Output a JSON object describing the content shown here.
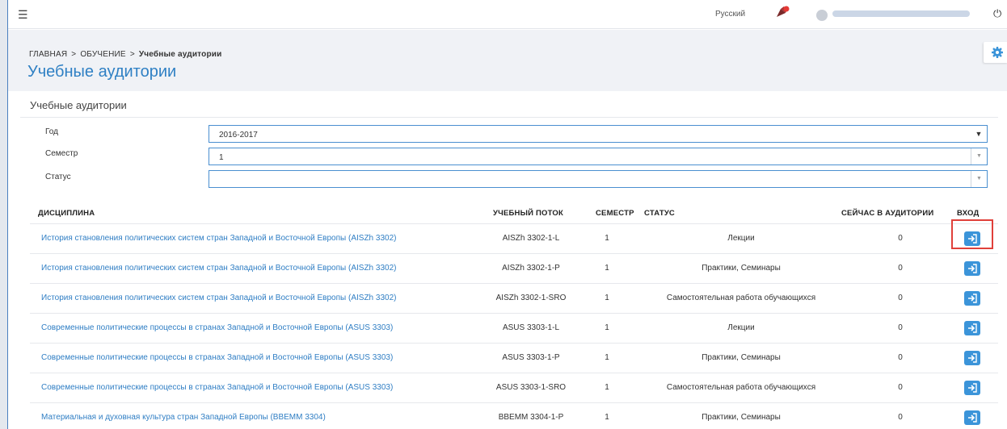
{
  "topbar": {
    "menu_icon": "menu-icon",
    "language": "Русский",
    "notification_icon": "notification-icon",
    "power_icon": "power-icon"
  },
  "breadcrumb": {
    "items": [
      "ГЛАВНАЯ",
      "ОБУЧЕНИЕ",
      "Учебные аудитории"
    ],
    "separator": ">"
  },
  "page": {
    "title": "Учебные аудитории",
    "settings_icon": "gear-icon"
  },
  "panel": {
    "title": "Учебные аудитории"
  },
  "filters": {
    "year": {
      "label": "Год",
      "value": "2016-2017"
    },
    "semester": {
      "label": "Семестр",
      "value": "1"
    },
    "status": {
      "label": "Статус",
      "value": ""
    }
  },
  "table": {
    "columns": [
      "ДИСЦИПЛИНА",
      "УЧЕБНЫЙ ПОТОК",
      "СЕМЕСТР",
      "СТАТУС",
      "СЕЙЧАС В АУДИТОРИИ",
      "ВХОД"
    ],
    "rows": [
      {
        "discipline": "История становления политических систем стран Западной и Восточной Европы (AISZh 3302)",
        "stream": "AISZh 3302-1-L",
        "semester": "1",
        "status": "Лекции",
        "now": "0"
      },
      {
        "discipline": "История становления политических систем стран Западной и Восточной Европы (AISZh 3302)",
        "stream": "AISZh 3302-1-P",
        "semester": "1",
        "status": "Практики, Семинары",
        "now": "0"
      },
      {
        "discipline": "История становления политических систем стран Западной и Восточной Европы (AISZh 3302)",
        "stream": "AISZh 3302-1-SRO",
        "semester": "1",
        "status": "Самостоятельная работа обучающихся",
        "now": "0"
      },
      {
        "discipline": "Современные политические процессы в странах Западной и Восточной Европы (ASUS 3303)",
        "stream": "ASUS 3303-1-L",
        "semester": "1",
        "status": "Лекции",
        "now": "0"
      },
      {
        "discipline": "Современные политические процессы в странах Западной и Восточной Европы (ASUS 3303)",
        "stream": "ASUS 3303-1-P",
        "semester": "1",
        "status": "Практики, Семинары",
        "now": "0"
      },
      {
        "discipline": "Современные политические процессы в странах Западной и Восточной Европы (ASUS 3303)",
        "stream": "ASUS 3303-1-SRO",
        "semester": "1",
        "status": "Самостоятельная работа обучающихся",
        "now": "0"
      },
      {
        "discipline": "Материальная и духовная культура стран Западной Европы (BBEMM 3304)",
        "stream": "BBEMM 3304-1-P",
        "semester": "1",
        "status": "Практики, Семинары",
        "now": "0"
      }
    ],
    "enter_icon": "sign-in-icon"
  },
  "colors": {
    "accent": "#2f80c4",
    "button": "#3b94d9",
    "highlight": "#e0403a"
  }
}
